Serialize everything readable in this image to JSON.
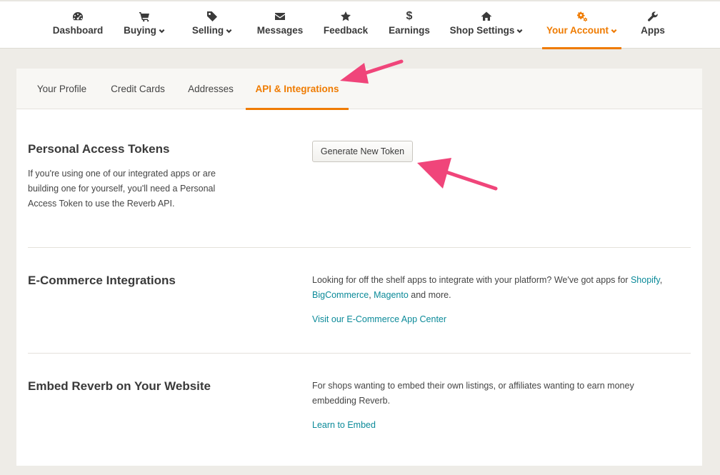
{
  "nav": {
    "items": [
      {
        "label": "Dashboard",
        "icon": "dashboard-icon",
        "dropdown": false
      },
      {
        "label": "Buying",
        "icon": "cart-icon",
        "dropdown": true
      },
      {
        "label": "Selling",
        "icon": "tag-icon",
        "dropdown": true
      },
      {
        "label": "Messages",
        "icon": "envelope-icon",
        "dropdown": false
      },
      {
        "label": "Feedback",
        "icon": "star-icon",
        "dropdown": false
      },
      {
        "label": "Earnings",
        "icon": "dollar-icon",
        "dropdown": false
      },
      {
        "label": "Shop Settings",
        "icon": "home-icon",
        "dropdown": true
      },
      {
        "label": "Your Account",
        "icon": "gears-icon",
        "dropdown": true,
        "active": true
      },
      {
        "label": "Apps",
        "icon": "wrench-icon",
        "dropdown": false
      }
    ]
  },
  "subtabs": [
    "Your Profile",
    "Credit Cards",
    "Addresses",
    "API & Integrations"
  ],
  "active_subtab": "API & Integrations",
  "tokens": {
    "title": "Personal Access Tokens",
    "description": "If you're using one of our integrated apps or are building one for yourself, you'll need a Personal Access Token to use the Reverb API.",
    "button": "Generate New Token"
  },
  "ecommerce": {
    "title": "E-Commerce Integrations",
    "text_before": "Looking for off the shelf apps to integrate with your platform? We've got apps for",
    "link_shopify": "Shopify",
    "link_bigcommerce": "BigCommerce",
    "link_magento": "Magento",
    "text_after": "and more.",
    "link_center": "Visit our E-Commerce App Center"
  },
  "embed": {
    "title": "Embed Reverb on Your Website",
    "text": "For shops wanting to embed their own listings, or affiliates wanting to earn money embedding Reverb.",
    "link": "Learn to Embed"
  },
  "colors": {
    "accent": "#ef7b00",
    "link": "#0b8a99",
    "annotation_arrow": "#f0457a",
    "background": "#eeece7"
  }
}
